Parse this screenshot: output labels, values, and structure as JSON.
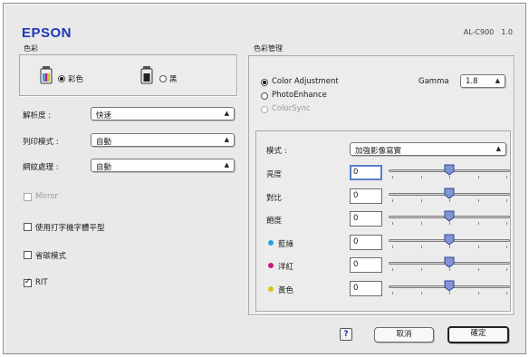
{
  "brand": "EPSON",
  "model": {
    "name": "AL-C900",
    "version": "1.0"
  },
  "ink": {
    "group_label": "色彩",
    "options": [
      {
        "label": "彩色",
        "selected": true
      },
      {
        "label": "黑",
        "selected": false
      }
    ]
  },
  "left_settings": [
    {
      "label": "解析度 :",
      "value": "快速"
    },
    {
      "label": "列印模式 :",
      "value": "自動"
    },
    {
      "label": "網紋處理 :",
      "value": "自動"
    }
  ],
  "checkboxes": [
    {
      "label": "Mirror",
      "checked": false,
      "disabled": true
    },
    {
      "label": "使用打字機字體平型",
      "checked": false,
      "disabled": false
    },
    {
      "label": "省碳模式",
      "checked": false,
      "disabled": false
    },
    {
      "label": "RIT",
      "checked": true,
      "disabled": false
    }
  ],
  "color_management": {
    "group_label": "色彩管理",
    "options": [
      {
        "label": "Color Adjustment",
        "selected": true,
        "disabled": false
      },
      {
        "label": "PhotoEnhance",
        "selected": false,
        "disabled": false
      },
      {
        "label": "ColorSync",
        "selected": false,
        "disabled": true
      }
    ],
    "gamma_label": "Gamma",
    "gamma_value": "1.8"
  },
  "adjustment": {
    "mode_label": "模式 :",
    "mode_value": "加強影像寫實",
    "sliders": [
      {
        "label": "亮度",
        "value": "0",
        "focused": true,
        "dot_color": "",
        "level": 0.5
      },
      {
        "label": "對比",
        "value": "0",
        "focused": false,
        "dot_color": "",
        "level": 0.5
      },
      {
        "label": "飽度",
        "value": "0",
        "focused": false,
        "dot_color": "",
        "level": 0.5
      },
      {
        "label": "藍綠",
        "value": "0",
        "focused": false,
        "dot_color": "#27a2dc",
        "level": 0.5
      },
      {
        "label": "洋紅",
        "value": "0",
        "focused": false,
        "dot_color": "#c4197a",
        "level": 0.5
      },
      {
        "label": "黃色",
        "value": "0",
        "focused": false,
        "dot_color": "#d8c31e",
        "level": 0.5
      }
    ]
  },
  "footer": {
    "help_label": "?",
    "cancel_label": "取消",
    "ok_label": "確定"
  }
}
